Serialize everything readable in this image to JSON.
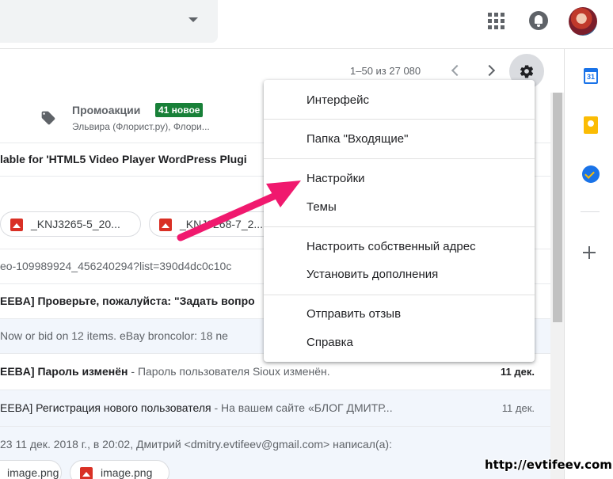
{
  "pager": {
    "range": "1–50 из 27 080"
  },
  "category": {
    "title": "Промоакции",
    "badge": "41 новое",
    "subtitle": "Эльвира (Флорист.ру), Флори..."
  },
  "rows": [
    {
      "text": "lable for 'HTML5 Video Player WordPress Plugi",
      "date": ""
    },
    {
      "text": "",
      "date": ""
    },
    {
      "text": "eo-109989924_456240294?list=390d4dc0c10c",
      "date": ""
    },
    {
      "subject": "EEBA] Проверьте, пожалуйста: \"Задать вопро",
      "date": ""
    },
    {
      "text": "Now or bid on 12 items. eBay broncolor: 18 ne",
      "date": ""
    },
    {
      "subject": "EEBA] Пароль изменён",
      "snippet": " - Пароль пользователя Sioux изменён.",
      "date": "11 дек."
    },
    {
      "subject": "EEBA] Регистрация нового пользователя",
      "snippet": " - На вашем сайте «БЛОГ ДМИТР...",
      "date": "11 дек."
    },
    {
      "text": "23 11 дек. 2018 г., в 20:02, Дмитрий <dmitry.evtifeev@gmail.com> написал(а):",
      "date": ""
    }
  ],
  "attachments": {
    "row1": [
      "_KNJ3265-5_20...",
      "_KNJ3268-7_2..."
    ],
    "row2": [
      "image.png",
      "image.png"
    ]
  },
  "menu": {
    "items": [
      "Интерфейс",
      "Папка \"Входящие\"",
      "Настройки",
      "Темы",
      "Настроить собственный адрес",
      "Установить дополнения",
      "Отправить отзыв",
      "Справка"
    ]
  },
  "side_panel": {
    "calendar_day": "31"
  },
  "watermark": "http://evtifeev.com",
  "colors": {
    "badge": "#188038",
    "arrow": "#f0196e",
    "accent": "#1a73e8"
  },
  "icons": [
    "apps-icon",
    "bell-icon",
    "gear-icon",
    "tag-icon",
    "calendar-icon",
    "keep-icon",
    "tasks-icon",
    "plus-icon",
    "image-icon",
    "chevron-left-icon",
    "chevron-right-icon"
  ]
}
